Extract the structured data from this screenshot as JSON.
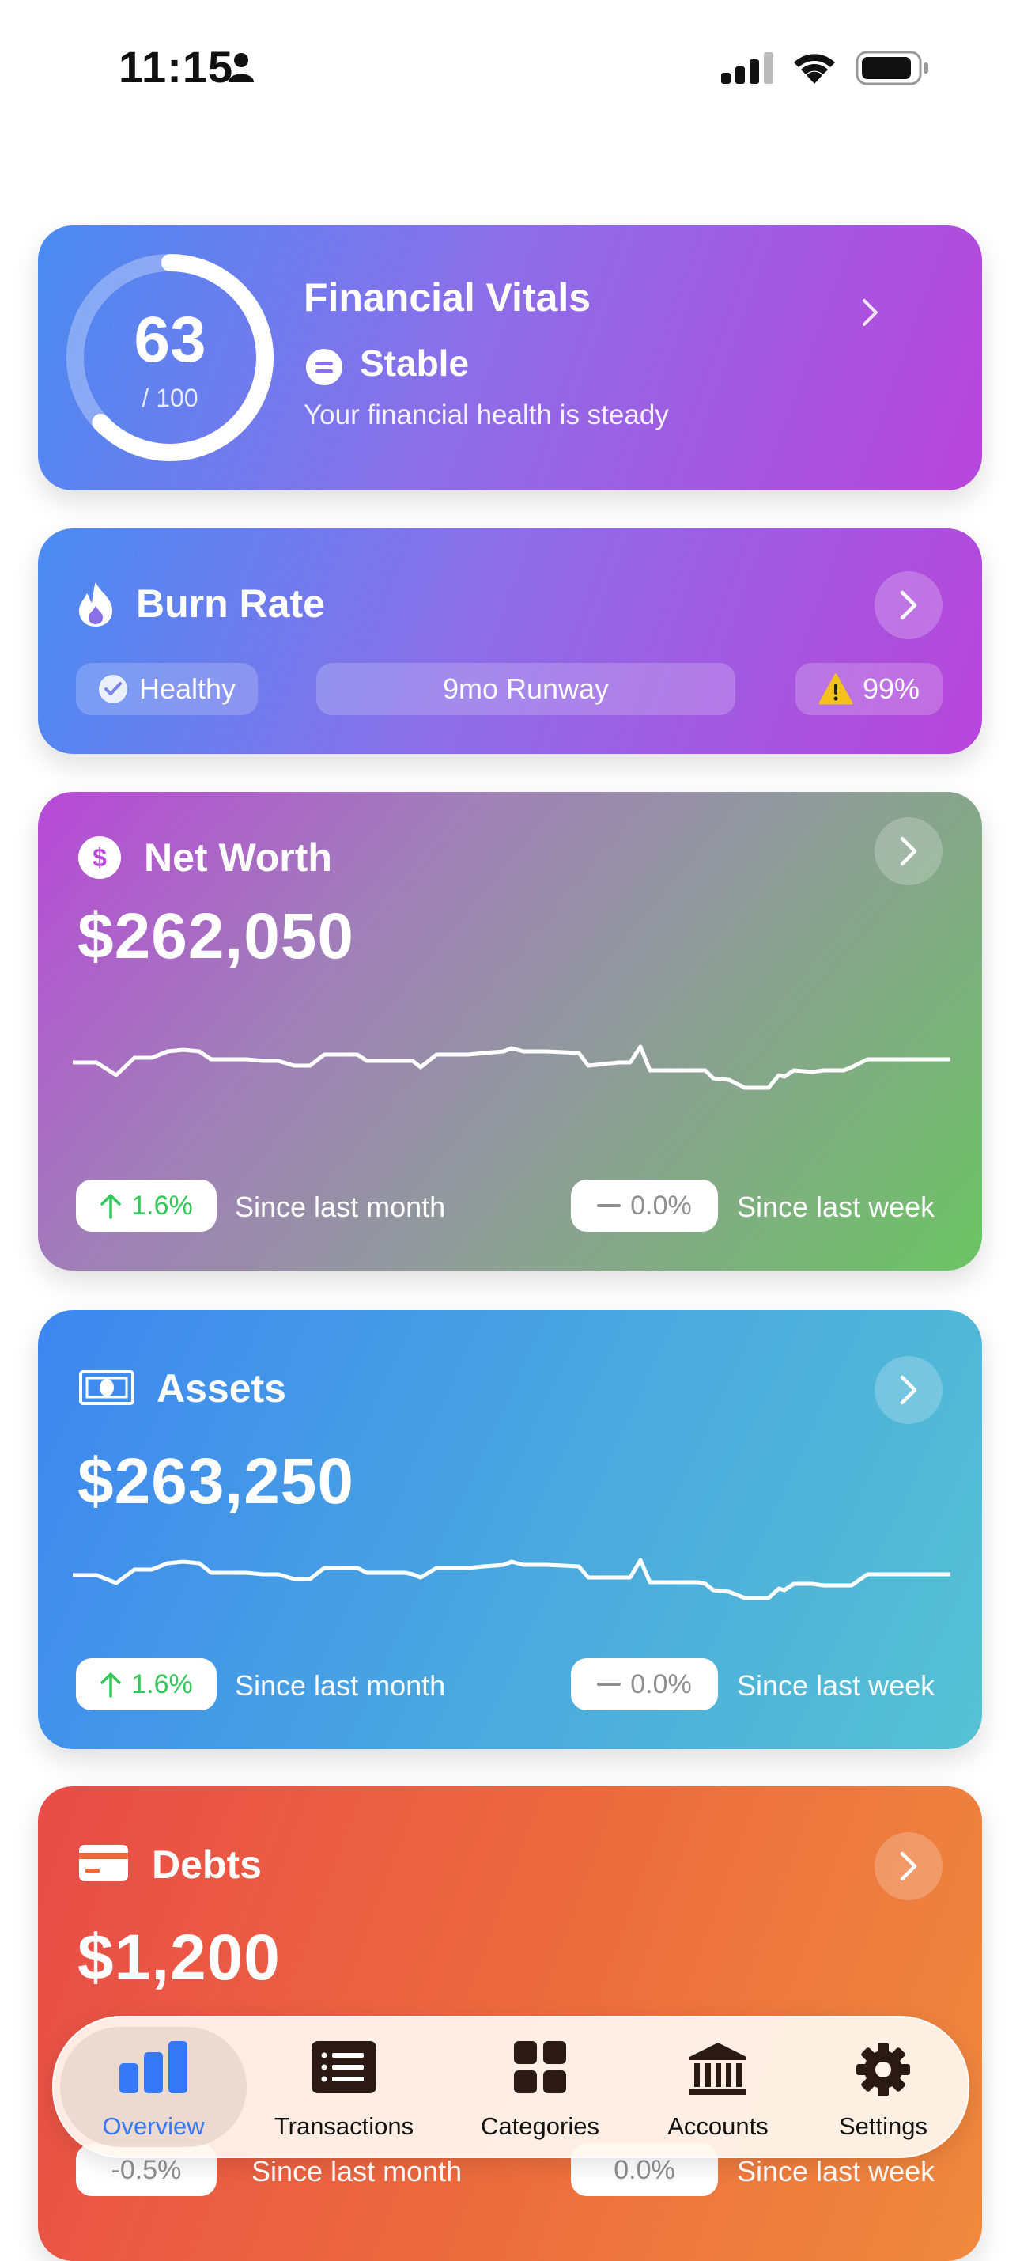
{
  "status_bar": {
    "time": "11:15"
  },
  "vitals": {
    "score": "63",
    "score_max": "/ 100",
    "score_value": 63,
    "title": "Financial Vitals",
    "status": "Stable",
    "description": "Your financial health is steady"
  },
  "burn_rate": {
    "title": "Burn Rate",
    "health": "Healthy",
    "runway": "9mo Runway",
    "warning": "99%"
  },
  "net_worth": {
    "title": "Net Worth",
    "value": "$262,050",
    "month_change": "1.6%",
    "month_label": "Since last month",
    "week_change": "0.0%",
    "week_label": "Since last week"
  },
  "assets": {
    "title": "Assets",
    "value": "$263,250",
    "month_change": "1.6%",
    "month_label": "Since last month",
    "week_change": "0.0%",
    "week_label": "Since last week"
  },
  "debts": {
    "title": "Debts",
    "value": "$1,200",
    "month_change": "-0.5%",
    "month_label": "Since last month",
    "week_change": "0.0%",
    "week_label": "Since last week"
  },
  "tabbar": {
    "items": [
      {
        "label": "Overview",
        "icon": "chart-bar-icon",
        "active": true
      },
      {
        "label": "Transactions",
        "icon": "list-icon",
        "active": false
      },
      {
        "label": "Categories",
        "icon": "grid-icon",
        "active": false
      },
      {
        "label": "Accounts",
        "icon": "bank-icon",
        "active": false
      },
      {
        "label": "Settings",
        "icon": "gear-icon",
        "active": false
      }
    ]
  },
  "colors": {
    "accent": "#3478f6",
    "positive": "#34c759",
    "neutral": "#8e8e93",
    "warning": "#f5c21b"
  }
}
